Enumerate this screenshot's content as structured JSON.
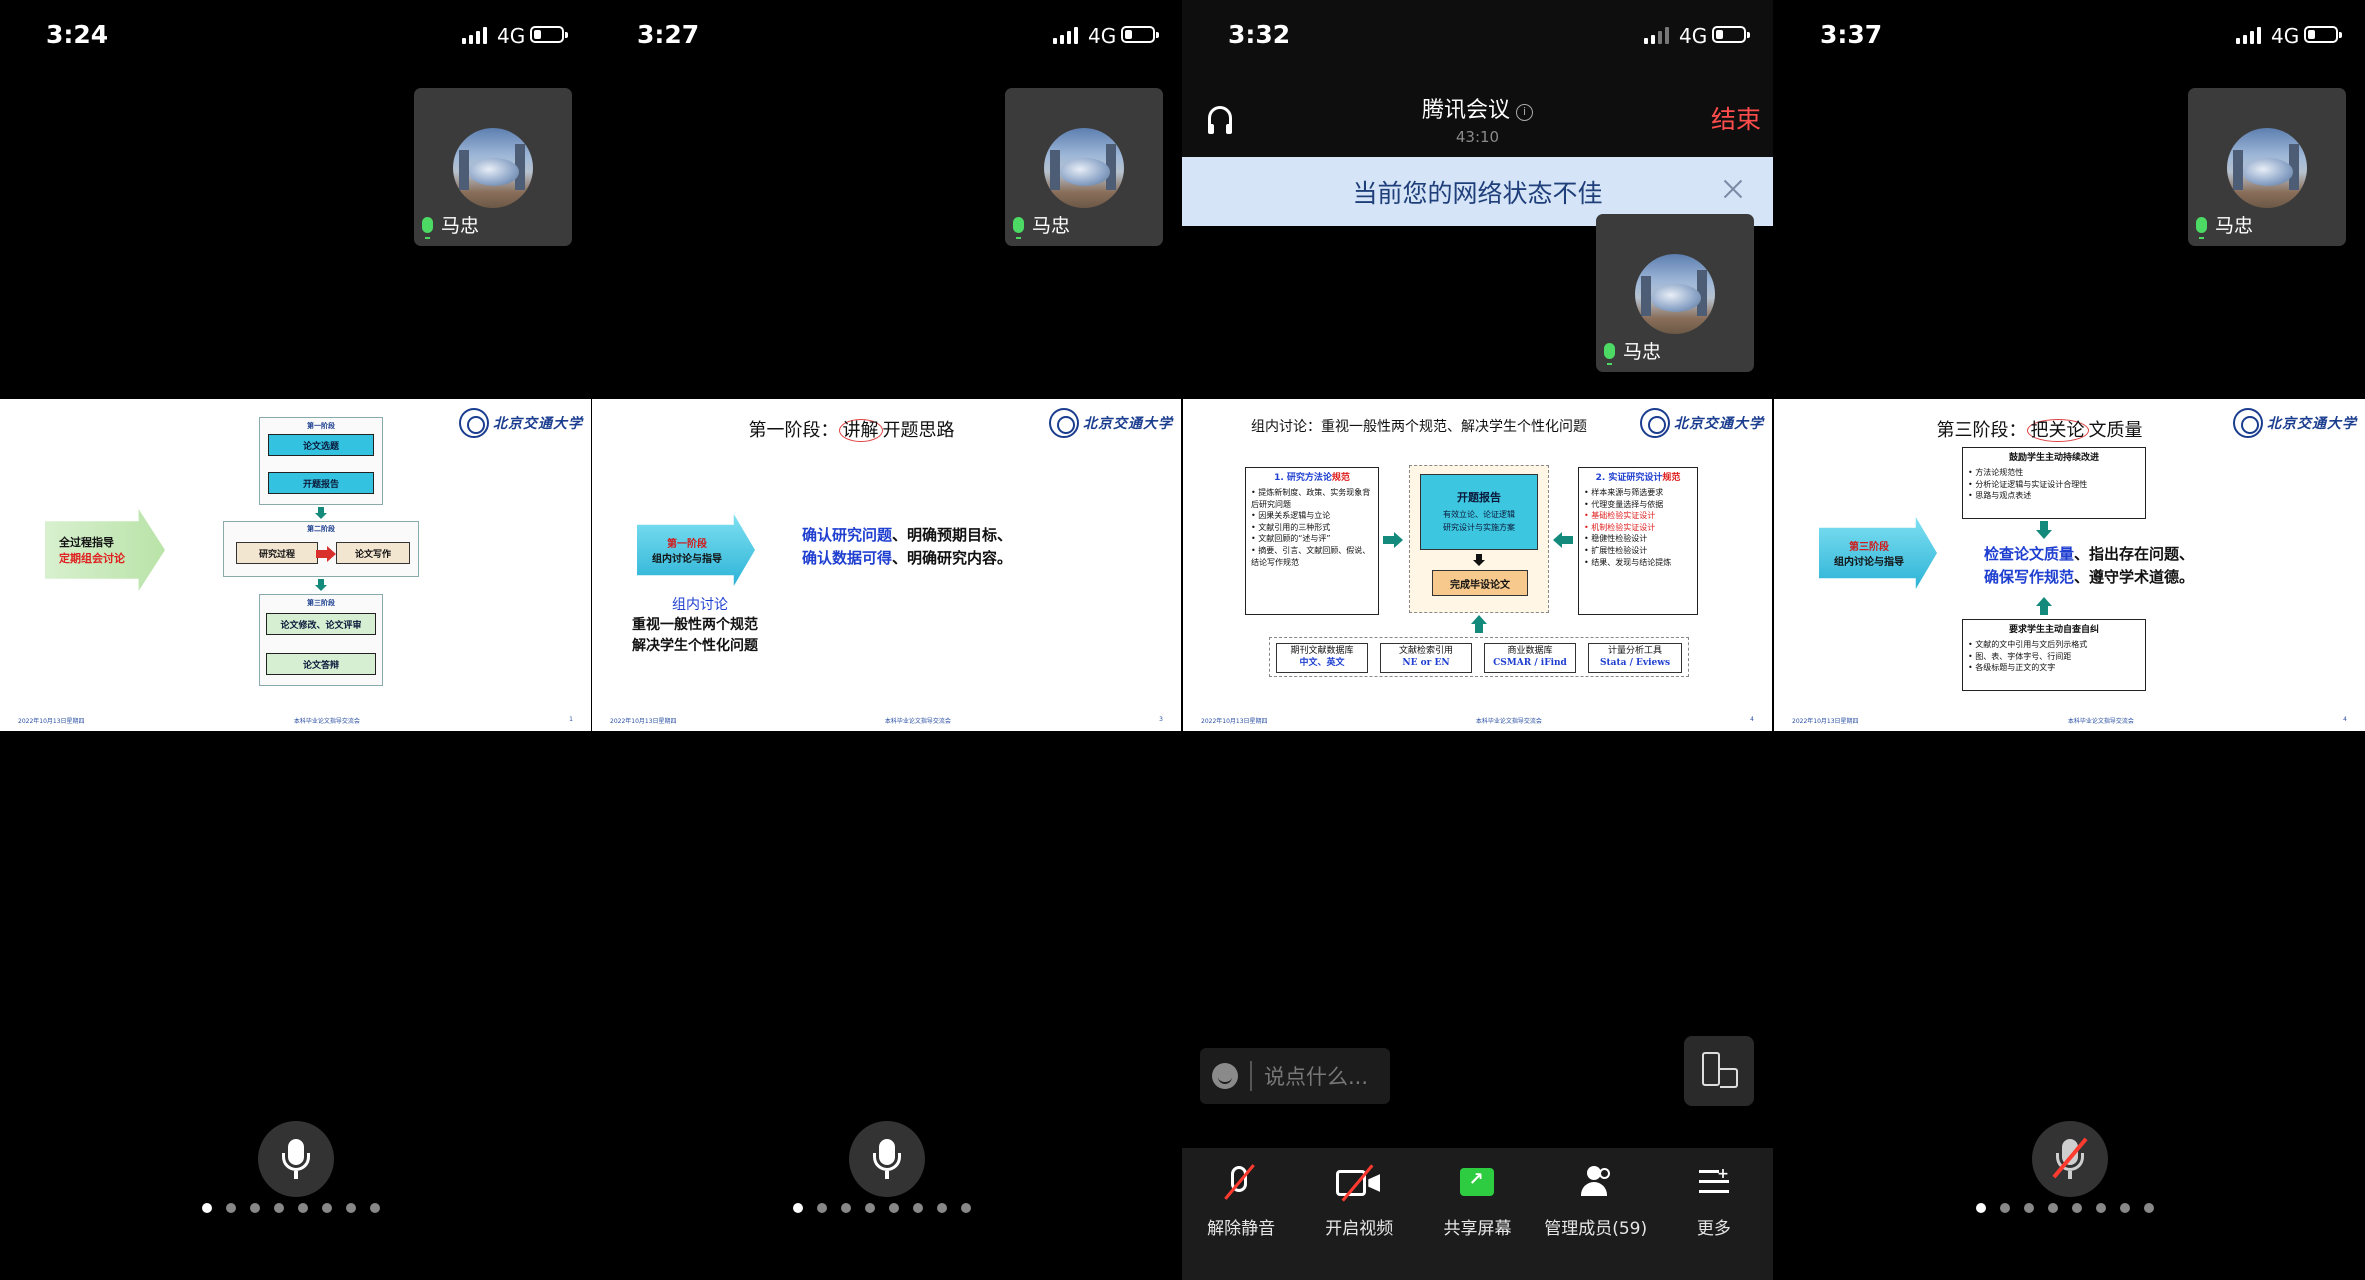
{
  "panels": [
    {
      "time": "3:24",
      "network": "4G",
      "participant": "马忠"
    },
    {
      "time": "3:27",
      "network": "4G",
      "participant": "马忠"
    },
    {
      "time": "3:32",
      "network": "4G",
      "participant": "马忠"
    },
    {
      "time": "3:37",
      "network": "4G",
      "participant": "马忠"
    }
  ],
  "meeting": {
    "title": "腾讯会议",
    "duration": "43:10",
    "end_label": "结束",
    "network_warning": "当前您的网络状态不佳",
    "chat_placeholder": "说点什么...",
    "toolbar": {
      "unmute": "解除静音",
      "video": "开启视频",
      "share": "共享屏幕",
      "members": "管理成员(59)",
      "more": "更多"
    }
  },
  "slides": {
    "footer_date": "2022年10月13日星期四",
    "footer_center": "本科毕业论文指导交流会",
    "logo_text": "北京交通大学",
    "s1": {
      "page": "1",
      "left_arrow_line1": "全过程指导",
      "left_arrow_line2": "定期组会讨论",
      "stage1": "第一阶段",
      "stage1_a": "论文选题",
      "stage1_b": "开题报告",
      "stage2": "第二阶段",
      "stage2_a": "研究过程",
      "stage2_b": "论文写作",
      "stage3": "第三阶段",
      "stage3_a": "论文修改、论文评审",
      "stage3_b": "论文答辩"
    },
    "s2": {
      "page": "3",
      "title_pre": "第一阶段：",
      "title_ring": "讲解",
      "title_post": "开题思路",
      "arrow_l1": "第一阶段",
      "arrow_l2": "组内讨论与指导",
      "line1_blue": "确认研究问题",
      "line1_rest": "、明确预期目标、",
      "line2_blue": "确认数据可得",
      "line2_rest": "、明确研究内容。",
      "sub_title": "组内讨论",
      "sub1": "重视一般性两个规范",
      "sub2": "解决学生个性化问题"
    },
    "s3": {
      "page": "4",
      "title": "组内讨论：重视一般性两个规范、解决学生个性化问题",
      "left_head_pre": "1. 研究方法论",
      "left_head_red": "规范",
      "left_items": [
        "提炼新制度、政策、实务现象背后研究问题",
        "因果关系逻辑与立论",
        "文献引用的三种形式",
        "文献回顾的“述与评”",
        "摘要、引言、文献回顾、假说、结论写作规范"
      ],
      "center_head": "开题报告",
      "center_l1": "有效立论、论证逻辑",
      "center_l2": "研究设计与实施方案",
      "center_bottom": "完成毕设论文",
      "right_head_pre": "2. 实证研究设计",
      "right_head_red": "规范",
      "right_items": [
        "样本来源与筛选要求",
        "代理变量选择与依据",
        "基础检验实证设计",
        "机制检验实证设计",
        "稳健性检验设计",
        "扩展性检验设计",
        "结果、发现与结论提炼"
      ],
      "tools": [
        {
          "name": "期刊文献数据库",
          "sub": "中文、英文"
        },
        {
          "name": "文献检索引用",
          "sub": "NE or EN"
        },
        {
          "name": "商业数据库",
          "sub": "CSMAR / iFind"
        },
        {
          "name": "计量分析工具",
          "sub": "Stata / Eviews"
        }
      ]
    },
    "s4": {
      "page": "4",
      "title_pre": "第三阶段：",
      "title_ring": "把关论",
      "title_post": "文质量",
      "top_head": "鼓励学生主动持续改进",
      "top_items": [
        "方法论规范性",
        "分析论证逻辑与实证设计合理性",
        "思路与观点表述"
      ],
      "arrow_l1": "第三阶段",
      "arrow_l2": "组内讨论与指导",
      "line1_blue": "检查论文质量",
      "line1_rest": "、指出存在问题、",
      "line2_blue": "确保写作规范",
      "line2_rest": "、遵守学术道德。",
      "bottom_head": "要求学生主动自查自纠",
      "bottom_items": [
        "文献的文中引用与文后列示格式",
        "图、表、字体字号、行间距",
        "各级标题与正文的文字"
      ]
    }
  },
  "icons": [
    "signal-icon",
    "battery-icon",
    "mic-icon",
    "headset-icon",
    "info-icon",
    "close-icon",
    "emoji-icon",
    "rotate-screen-icon",
    "mic-muted-icon",
    "camera-off-icon",
    "share-screen-icon",
    "members-icon",
    "more-icon"
  ],
  "colors": {
    "end": "#ff4d4d",
    "banner_bg": "#d6e4f7",
    "mic_active": "#4cd964",
    "share": "#2ecc40"
  }
}
